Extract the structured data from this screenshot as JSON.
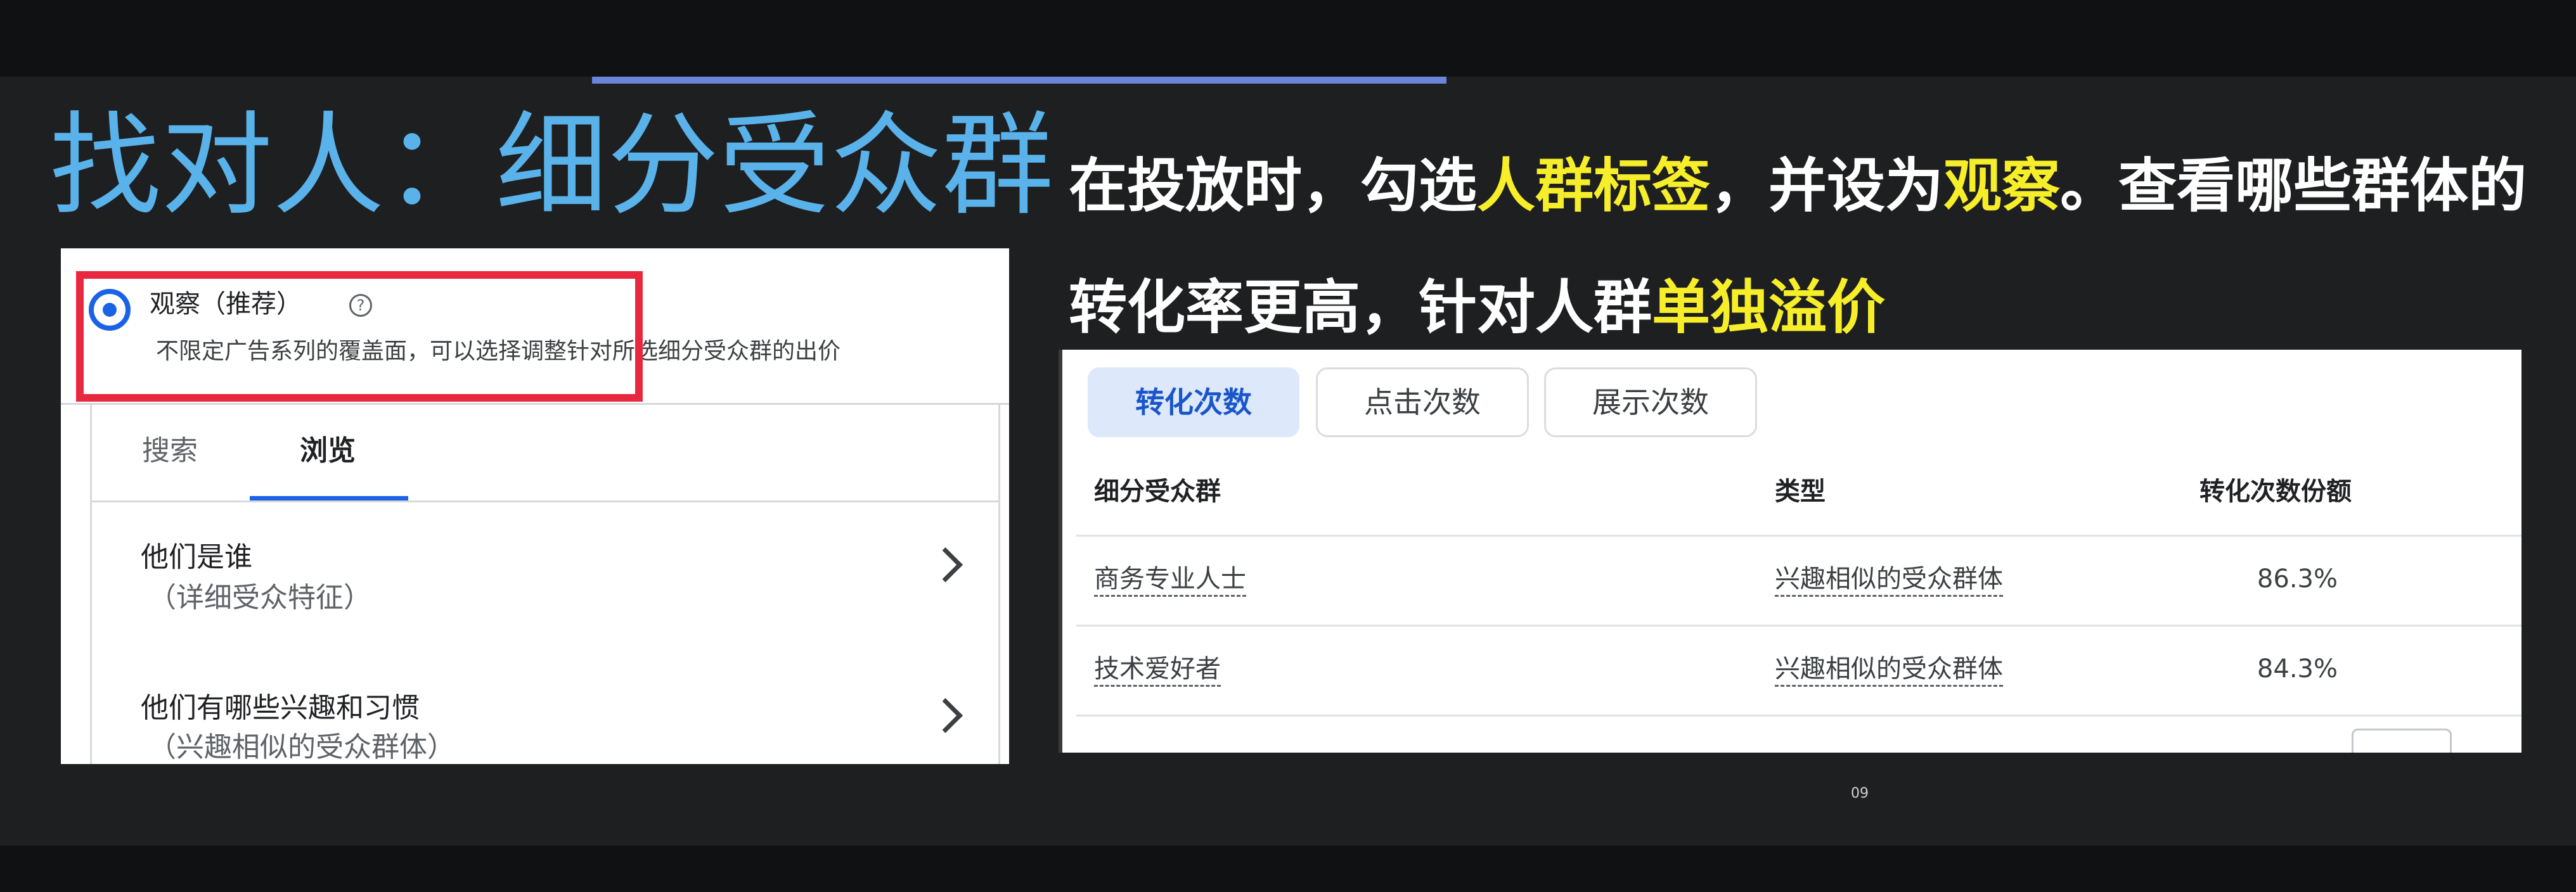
{
  "slide": {
    "title": "找对人：细分受众群",
    "description": {
      "part1": "在投放时，勾选",
      "highlight1": "人群标签",
      "part2": "，并设为",
      "highlight2": "观察",
      "part3": "。查看哪些群体的转化率更高，针对人群",
      "highlight3": "单独溢价"
    },
    "page_number": "09",
    "colors": {
      "title": "#5ab2ea",
      "highlight": "#f7ee2a",
      "accent_line": "#6b86d8",
      "callout_box": "#e8283f",
      "selected_blue": "#1a62e6"
    }
  },
  "left_screenshot": {
    "option": {
      "label": "观察（推荐）",
      "help_icon": "help-circle-icon",
      "help_glyph": "?",
      "description": "不限定广告系列的覆盖面，可以选择调整针对所选细分受众群的出价",
      "selected": true
    },
    "tabs": [
      {
        "label": "搜索",
        "active": false
      },
      {
        "label": "浏览",
        "active": true
      }
    ],
    "nav_items": [
      {
        "title": "他们是谁",
        "subtitle": "（详细受众特征）",
        "icon": "chevron-right-icon"
      },
      {
        "title": "他们有哪些兴趣和习惯",
        "subtitle": "（兴趣相似的受众群体）",
        "icon": "chevron-right-icon"
      }
    ]
  },
  "right_screenshot": {
    "chips": [
      {
        "label": "转化次数",
        "active": true
      },
      {
        "label": "点击次数",
        "active": false
      },
      {
        "label": "展示次数",
        "active": false
      }
    ],
    "table": {
      "headers": [
        "细分受众群",
        "类型",
        "转化次数份额"
      ],
      "rows": [
        {
          "segment": "商务专业人士",
          "type": "兴趣相似的受众群体",
          "share": "86.3%"
        },
        {
          "segment": "技术爱好者",
          "type": "兴趣相似的受众群体",
          "share": "84.3%"
        }
      ]
    }
  }
}
